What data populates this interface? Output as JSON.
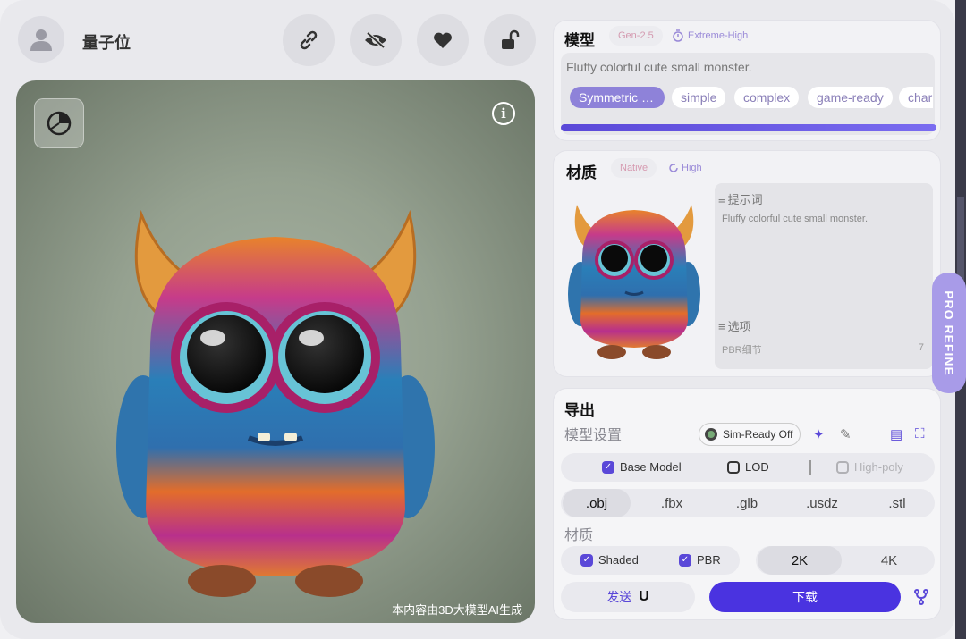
{
  "header": {
    "username": "量子位",
    "buttons": [
      "link-icon",
      "eye-off-icon",
      "heart-icon",
      "unlock-icon"
    ]
  },
  "preview": {
    "caption": "本内容由3D大模型AI生成",
    "info_glyph": "i"
  },
  "model_panel": {
    "title": "模型",
    "gen_tag": "Gen-2.5",
    "quality_tag": "Extreme-High",
    "prompt": "Fluffy colorful cute small monster.",
    "chips": [
      "Symmetric …",
      "simple",
      "complex",
      "game-ready",
      "char"
    ],
    "selected_chip": 0,
    "progress": 1.0
  },
  "material_panel": {
    "title": "材质",
    "native_tag": "Native",
    "quality_tag": "High",
    "prompt_label": "提示词",
    "prompt_text": "Fluffy colorful cute small monster.",
    "options_label": "选项",
    "pbr_label": "PBR细节",
    "pbr_value": "7"
  },
  "pro_refine": "PRO REFINE",
  "export_panel": {
    "title": "导出",
    "model_settings_label": "模型设置",
    "sim_ready": "Sim-Ready Off",
    "base_model": "Base Model",
    "lod": "LOD",
    "high_poly": "High-poly",
    "formats": [
      ".obj",
      ".fbx",
      ".glb",
      ".usdz",
      ".stl"
    ],
    "selected_format": ".obj",
    "material_label": "材质",
    "shaded": "Shaded",
    "pbr": "PBR",
    "resolutions": [
      "2K",
      "4K"
    ],
    "selected_resolution": "2K",
    "send": "发送",
    "download": "下载"
  },
  "colors": {
    "accent": "#4a33e0",
    "chip_selected": "#8e82d9",
    "pro_refine": "#a89be8"
  }
}
